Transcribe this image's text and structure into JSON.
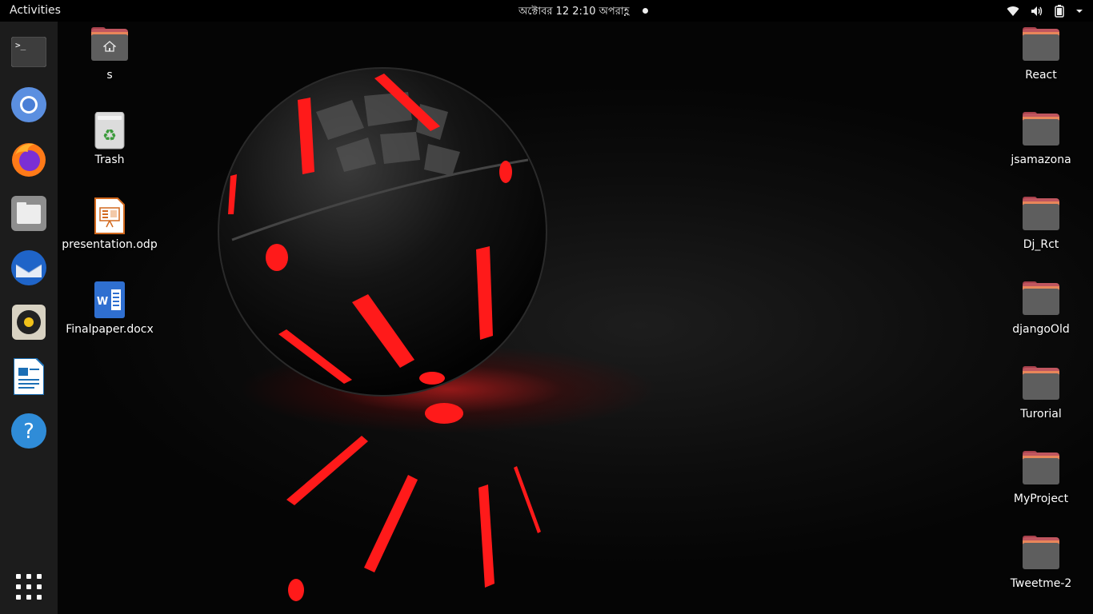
{
  "topbar": {
    "activities_label": "Activities",
    "clock": "অক্টোবর 12  2:10 অপরাহ্ণ"
  },
  "colors": {
    "dock_bg": "#1c1c1c",
    "folder_front": "#5e5e5e",
    "folder_back": "#c0565f",
    "folder_stripe": "#e8865a",
    "wallpaper_accent": "#ff1a1a"
  },
  "dock": [
    {
      "name": "terminal-icon"
    },
    {
      "name": "chromium-icon"
    },
    {
      "name": "firefox-icon"
    },
    {
      "name": "files-icon"
    },
    {
      "name": "thunderbird-icon"
    },
    {
      "name": "rhythmbox-icon"
    },
    {
      "name": "libreoffice-writer-icon"
    },
    {
      "name": "help-icon"
    },
    {
      "name": "show-applications-icon"
    }
  ],
  "desktop_left": [
    {
      "label": "s",
      "icon": "home-folder-icon"
    },
    {
      "label": "Trash",
      "icon": "trash-icon"
    },
    {
      "label": "presentation.odp",
      "icon": "presentation-file-icon"
    },
    {
      "label": "Finalpaper.docx",
      "icon": "word-document-icon"
    }
  ],
  "desktop_right": [
    {
      "label": "React",
      "icon": "folder-icon"
    },
    {
      "label": "jsamazona",
      "icon": "folder-icon"
    },
    {
      "label": "Dj_Rct",
      "icon": "folder-icon"
    },
    {
      "label": "djangoOld",
      "icon": "folder-icon"
    },
    {
      "label": "Turorial",
      "icon": "folder-icon"
    },
    {
      "label": "MyProject",
      "icon": "folder-icon"
    },
    {
      "label": "Tweetme-2",
      "icon": "folder-icon"
    }
  ]
}
